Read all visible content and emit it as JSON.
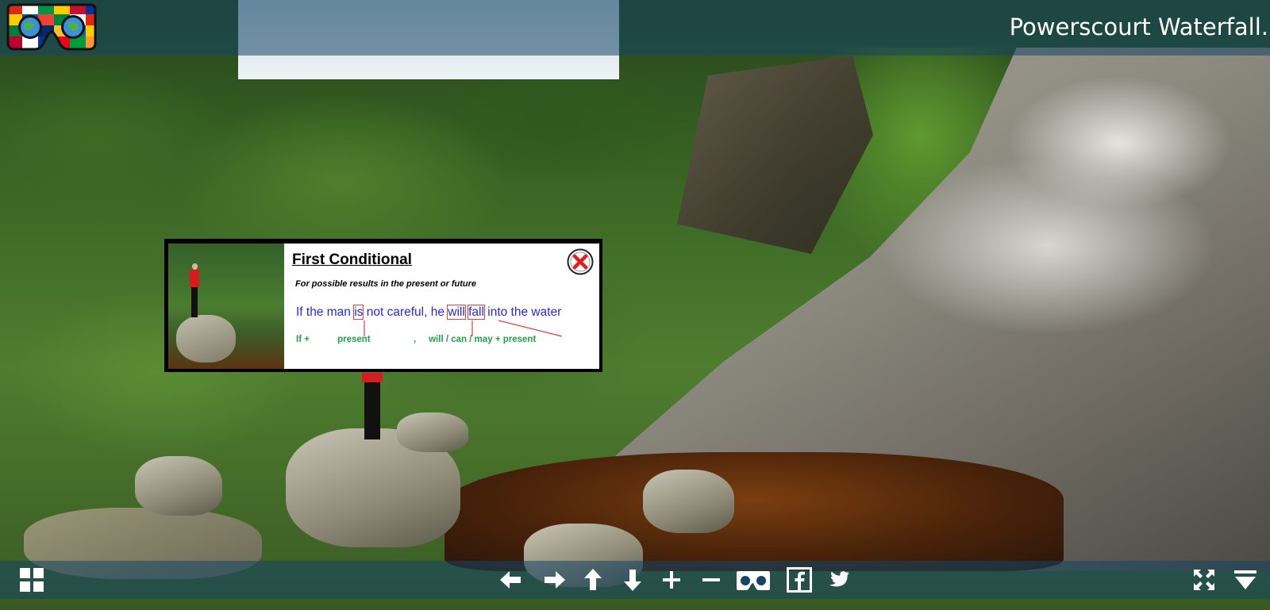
{
  "header": {
    "title": "Powerscourt Waterfall."
  },
  "popup": {
    "title": "First Conditional",
    "subtitle": "For possible results in the present or future",
    "sentence": {
      "part1": "If the man ",
      "is": "is",
      "part2": " not careful, he ",
      "will": "will",
      "space": " ",
      "fall": "fall",
      "part3": " into the water"
    },
    "formula": "If +           present                 ,     will / can / may + present"
  },
  "toolbar": {
    "icons": [
      "thumbnails-icon",
      "arrow-left-icon",
      "arrow-right-icon",
      "arrow-up-icon",
      "arrow-down-icon",
      "zoom-in-icon",
      "zoom-out-icon",
      "vr-headset-icon",
      "facebook-icon",
      "twitter-icon",
      "fullscreen-icon",
      "menu-down-icon"
    ]
  },
  "colors": {
    "bar": "#14466480",
    "sentence_blue": "#2a2ad0",
    "highlight_red": "#e0403a",
    "formula_green": "#23a04a",
    "close_red": "#e02020"
  }
}
